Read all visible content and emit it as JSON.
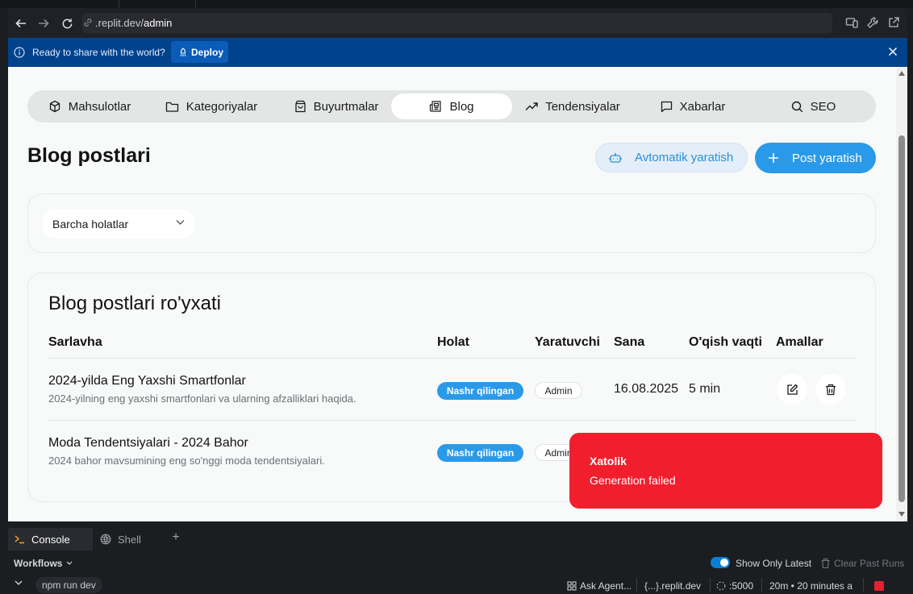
{
  "browser": {
    "url_host": ".replit.dev/",
    "url_path": "admin"
  },
  "banner": {
    "text": "Ready to share with the world?",
    "deploy_label": "Deploy"
  },
  "tabs": [
    {
      "label": "Mahsulotlar",
      "icon": "cube-icon"
    },
    {
      "label": "Kategoriyalar",
      "icon": "folder-icon"
    },
    {
      "label": "Buyurtmalar",
      "icon": "shopping-bag-icon"
    },
    {
      "label": "Blog",
      "icon": "newspaper-icon",
      "active": true
    },
    {
      "label": "Tendensiyalar",
      "icon": "trending-up-icon"
    },
    {
      "label": "Xabarlar",
      "icon": "message-icon"
    },
    {
      "label": "SEO",
      "icon": "search-icon"
    }
  ],
  "page": {
    "title": "Blog postlari",
    "auto_label": "Avtomatik yaratish",
    "create_label": "Post yaratish"
  },
  "filter": {
    "value": "Barcha holatlar"
  },
  "list": {
    "title": "Blog postlari ro'yxati",
    "columns": [
      "Sarlavha",
      "Holat",
      "Yaratuvchi",
      "Sana",
      "O'qish vaqti",
      "Amallar"
    ],
    "rows": [
      {
        "title": "2024-yilda Eng Yaxshi Smartfonlar",
        "description": "2024-yilning eng yaxshi smartfonlari va ularning afzalliklari haqida.",
        "status": "Nashr qilingan",
        "author": "Admin",
        "date": "16.08.2025",
        "read_time": "5 min"
      },
      {
        "title": "Moda Tendentsiyalari - 2024 Bahor",
        "description": "2024 bahor mavsumining eng so'nggi moda tendentsiyalari.",
        "status": "Nashr qilingan",
        "author": "Admin"
      }
    ]
  },
  "toast": {
    "title": "Xatolik",
    "message": "Generation failed"
  },
  "bottom": {
    "console_tab": "Console",
    "shell_tab": "Shell",
    "add_tab": "+",
    "workflows_label": "Workflows",
    "show_latest_label": "Show Only Latest",
    "show_latest_on": true,
    "clear_runs_label": "Clear Past Runs",
    "workflow_name": "npm run dev",
    "ask_agent": "Ask Agent...",
    "domain": "{...}.replit.dev",
    "port": ":5000",
    "run_time": "20m • 20 minutes a"
  },
  "colors": {
    "accent": "#2a9ae8",
    "banner": "#00428c",
    "toast": "#f11f2e"
  }
}
